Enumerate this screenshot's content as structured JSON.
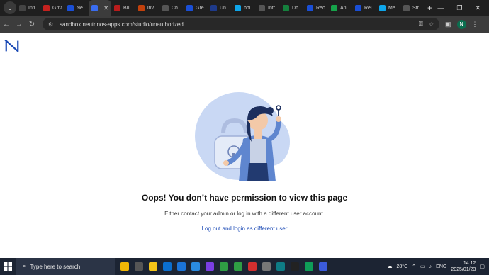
{
  "browser": {
    "tabs": [
      {
        "label": "Inti",
        "color": "#444"
      },
      {
        "label": "Gmail",
        "color": "#c5221f"
      },
      {
        "label": "Ne",
        "color": "#1a4fd6"
      },
      {
        "label": "α",
        "color": "#3a6df0"
      },
      {
        "label": "Bu",
        "color": "#b91c1c"
      },
      {
        "label": "inv",
        "color": "#c2410c"
      },
      {
        "label": "Ch",
        "color": "#555"
      },
      {
        "label": "Gre",
        "color": "#1a4fd6"
      },
      {
        "label": "Un",
        "color": "#1e3a8a"
      },
      {
        "label": "bhi",
        "color": "#0ea5e9"
      },
      {
        "label": "Intr",
        "color": "#555"
      },
      {
        "label": "Db",
        "color": "#15803d"
      },
      {
        "label": "Rec",
        "color": "#1a4fd6"
      },
      {
        "label": "Ani",
        "color": "#16a34a"
      },
      {
        "label": "Rei",
        "color": "#1a4fd6"
      },
      {
        "label": "Me",
        "color": "#0ea5e9"
      },
      {
        "label": "Str",
        "color": "#555"
      }
    ],
    "active_tab_index": 3,
    "new_tab": "+",
    "url": "sandbox.neutrinos-apps.com/studio/unauthorized",
    "profile_initial": "N"
  },
  "page": {
    "title": "Oops! You don’t have permission to view this page",
    "description": "Either contact your admin or log in with a different user account.",
    "link": "Log out and login as different user"
  },
  "taskbar": {
    "search_placeholder": "Type here to search",
    "weather": "28°C",
    "language": "ENG",
    "time": "14:12",
    "date": "2025/01/23",
    "apps": [
      {
        "name": "file-explorer-folder",
        "color": "#f2b705"
      },
      {
        "name": "task-view",
        "color": "#555"
      },
      {
        "name": "explorer",
        "color": "#f5c518"
      },
      {
        "name": "store",
        "color": "#0b6fcf"
      },
      {
        "name": "photos",
        "color": "#1b74d8"
      },
      {
        "name": "vscode",
        "color": "#2a8be0"
      },
      {
        "name": "edge-purple",
        "color": "#7b3fe4"
      },
      {
        "name": "chrome",
        "color": "#2f9e44"
      },
      {
        "name": "chrome-active",
        "color": "#2f9e44"
      },
      {
        "name": "app-red",
        "color": "#d32f2f"
      },
      {
        "name": "settings",
        "color": "#777"
      },
      {
        "name": "snip",
        "color": "#0e7c86"
      },
      {
        "name": "terminal",
        "color": "#222"
      },
      {
        "name": "edge",
        "color": "#0f9d58"
      },
      {
        "name": "bluetooth-like",
        "color": "#3b5bdb"
      }
    ]
  }
}
